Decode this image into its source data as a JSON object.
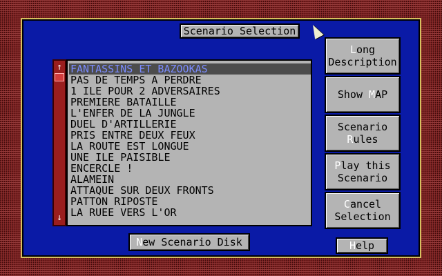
{
  "dialog": {
    "title": "Scenario Selection"
  },
  "scrollbar": {
    "up_arrow": "↑",
    "down_arrow": "↓"
  },
  "scenario_list": {
    "selected_index": 0,
    "items": [
      "FANTASSINS ET BAZOOKAS",
      "PAS DE TEMPS A PERDRE",
      "1 ILE POUR 2 ADVERSAIRES",
      "PREMIERE BATAILLE",
      "L'ENFER DE LA JUNGLE",
      "DUEL D'ARTILLERIE",
      "PRIS ENTRE DEUX FEUX",
      "LA ROUTE EST LONGUE",
      "UNE ILE PAISIBLE",
      "ENCERCLE !",
      "ALAMEIN",
      "ATTAQUE SUR DEUX FRONTS",
      "PATTON RIPOSTE",
      "LA RUEE VERS L'OR"
    ]
  },
  "buttons": {
    "long_description": {
      "l1_hk": "L",
      "l1_rest": "ong",
      "l2": "Description"
    },
    "show_map": {
      "pre": "Show ",
      "hk": "M",
      "post": "AP"
    },
    "scenario_rules": {
      "l1": "Scenario",
      "l2_hk": "R",
      "l2_rest": "ules"
    },
    "play_scenario": {
      "l1_hk": "P",
      "l1_rest": "lay this",
      "l2": "Scenario"
    },
    "cancel_selection": {
      "l1_hk": "C",
      "l1_rest": "ancel",
      "l2": "Selection"
    },
    "new_scenario_disk": {
      "hk": "N",
      "rest": "ew Scenario Disk"
    },
    "help": {
      "hk": "H",
      "rest": "elp"
    }
  },
  "colors": {
    "dialog_bg": "#0a1aa6",
    "dialog_border": "#d8c060",
    "button_bg": "#b4b4b4",
    "selected_bg": "#4c4c4c",
    "selected_text": "#7b8cff",
    "scrollbar": "#9a1e1e"
  }
}
